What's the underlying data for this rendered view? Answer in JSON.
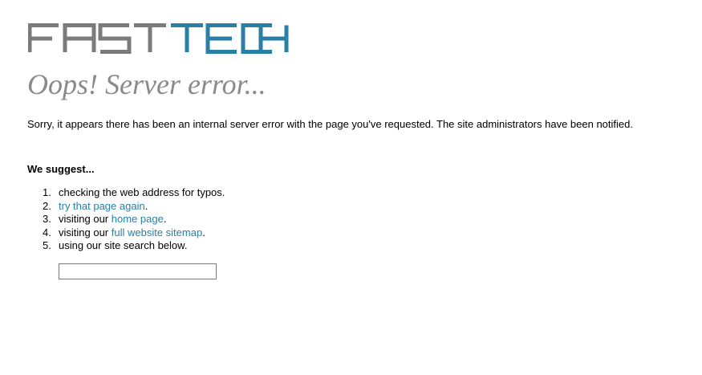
{
  "logo": {
    "text_part1": "FAST",
    "text_part2": "TECH",
    "color_part1": "#7b7b7b",
    "color_part2": "#2a7fa5"
  },
  "title": "Oops! Server error...",
  "message": "Sorry, it appears there has been an internal server error with the page you've requested. The site administrators have been notified.",
  "suggest": {
    "heading": "We suggest...",
    "items": [
      {
        "number": "1.",
        "before": "checking the web address for typos.",
        "link": "",
        "after": ""
      },
      {
        "number": "2.",
        "before": "",
        "link": "try that page again",
        "after": "."
      },
      {
        "number": "3.",
        "before": "visiting our ",
        "link": "home page",
        "after": "."
      },
      {
        "number": "4.",
        "before": "visiting our ",
        "link": "full website sitemap",
        "after": "."
      },
      {
        "number": "5.",
        "before": "using our site search below.",
        "link": "",
        "after": ""
      }
    ]
  },
  "search": {
    "value": "",
    "placeholder": ""
  },
  "colors": {
    "link": "#2a7fa5",
    "title": "#8a8a8a"
  }
}
